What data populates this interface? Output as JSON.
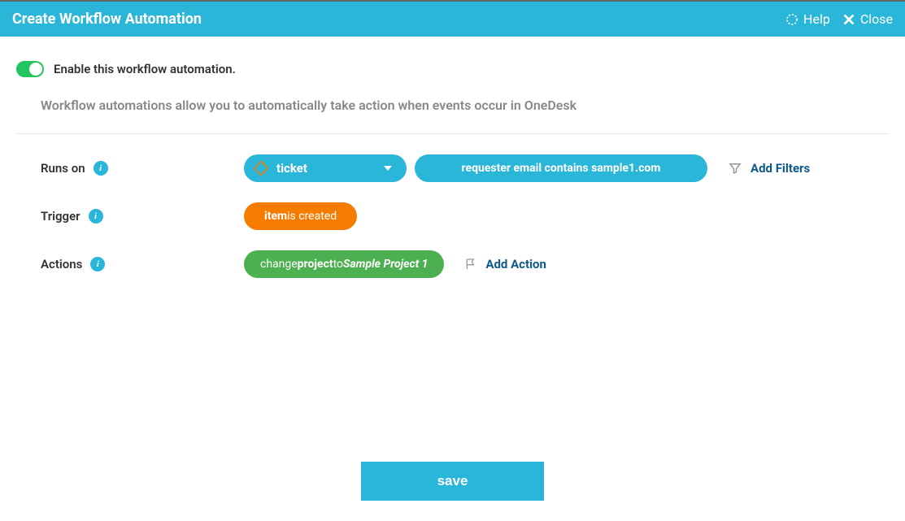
{
  "header": {
    "title": "Create Workflow Automation",
    "help": "Help",
    "close": "Close"
  },
  "enable_label": "Enable this workflow automation.",
  "description": "Workflow automations allow you to automatically take action when events occur in OneDesk",
  "rows": {
    "runs_on": "Runs on",
    "trigger": "Trigger",
    "actions": "Actions"
  },
  "runs_on": {
    "type_label": "ticket",
    "filter_text": "requester email contains sample1.com",
    "add_filters": "Add Filters"
  },
  "trigger": {
    "subject": "item",
    "verb": " is created"
  },
  "action": {
    "verb": "change ",
    "field": "project",
    "to": " to ",
    "value": "Sample Project 1",
    "add_action": "Add Action"
  },
  "save": "save"
}
